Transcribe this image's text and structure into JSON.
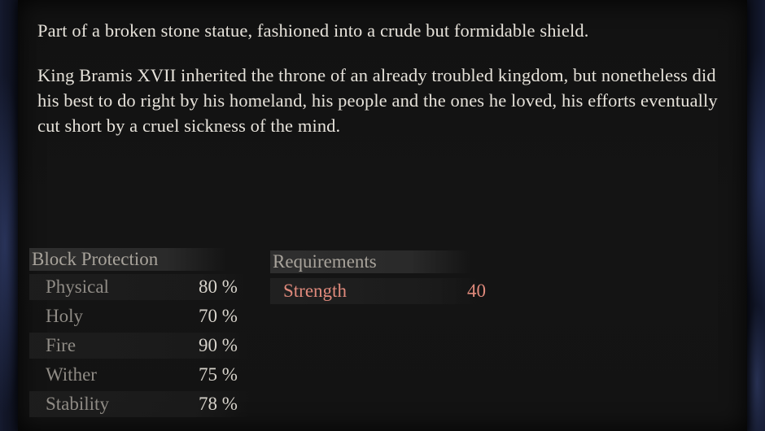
{
  "description": {
    "paragraph_1": "Part of a broken stone statue, fashioned into a crude but formidable shield.",
    "paragraph_2": "King Bramis XVII inherited the throne of an already troubled kingdom, but nonetheless did his best to do right by his homeland, his people and the ones he loved, his efforts eventually cut short by a cruel sickness of the mind."
  },
  "block_protection": {
    "header": "Block Protection",
    "rows": [
      {
        "label": "Physical",
        "value": "80 %"
      },
      {
        "label": "Holy",
        "value": "70 %"
      },
      {
        "label": "Fire",
        "value": "90 %"
      },
      {
        "label": "Wither",
        "value": "75 %"
      },
      {
        "label": "Stability",
        "value": "78 %"
      }
    ]
  },
  "requirements": {
    "header": "Requirements",
    "rows": [
      {
        "label": "Strength",
        "value": "40"
      }
    ]
  },
  "colors": {
    "requirement_unmet": "#e08a7c",
    "text_primary": "#e6e2da",
    "text_muted": "#8f8b85"
  }
}
